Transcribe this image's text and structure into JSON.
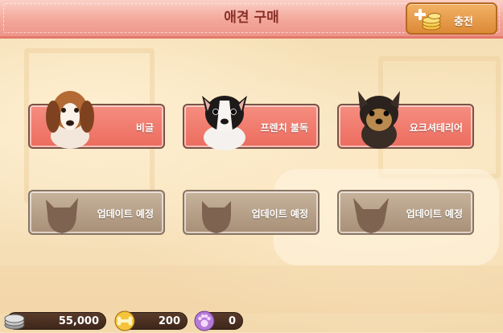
{
  "header": {
    "title": "애견 구매",
    "charge_label": "충전"
  },
  "dogs": [
    {
      "label": "비글",
      "status": "available",
      "icon": "beagle-portrait"
    },
    {
      "label": "프렌치 불독",
      "status": "available",
      "icon": "french-bulldog-portrait"
    },
    {
      "label": "요크셔테리어",
      "status": "available",
      "icon": "yorkshire-terrier-portrait"
    },
    {
      "label": "업데이트 예정",
      "status": "locked",
      "icon": "dog-silhouette"
    },
    {
      "label": "업데이트 예정",
      "status": "locked",
      "icon": "dog-silhouette"
    },
    {
      "label": "업데이트 예정",
      "status": "locked",
      "icon": "dog-silhouette"
    }
  ],
  "currency": {
    "silver": "55,000",
    "gold": "200",
    "paw": "0"
  },
  "colors": {
    "header": "#f3a79a",
    "card_active": "#ec6c5e",
    "card_locked": "#a88f77",
    "charge_button": "#dc8a36"
  }
}
